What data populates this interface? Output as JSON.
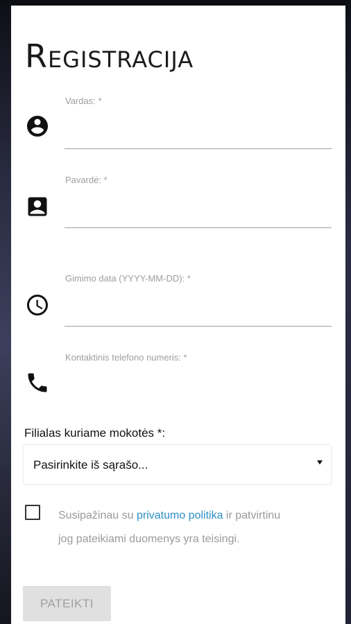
{
  "form": {
    "title": "Registracija",
    "fields": [
      {
        "label": "Vardas: *",
        "value": "",
        "icon": "account-circle-icon"
      },
      {
        "label": "Pavardė: *",
        "value": "",
        "icon": "contact-card-icon"
      },
      {
        "label": "Gimimo data (YYYY-MM-DD): *",
        "value": "",
        "icon": "clock-icon"
      },
      {
        "label": "Kontaktinis telefono numeris: *",
        "value": "",
        "icon": "phone-icon"
      }
    ],
    "branch": {
      "label": "Filialas kuriame mokotės *:",
      "selected": "Pasirinkite iš sąrašo..."
    },
    "consent": {
      "checked": false,
      "text_before": "Susipažinau su ",
      "link_text": "privatumo politika",
      "text_after": " ir patvirtinu jog pateikiami duomenys yra teisingi."
    },
    "submit_label": "PATEIKTI"
  },
  "colors": {
    "label_gray": "#9e9e9e",
    "link_blue": "#2b8ec6",
    "button_bg": "#e0e0e0",
    "button_text": "#9e9e9e"
  }
}
